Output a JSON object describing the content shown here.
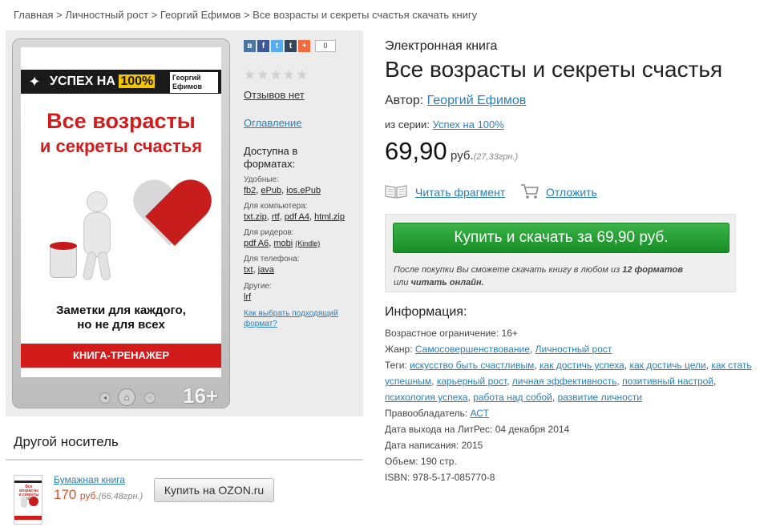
{
  "breadcrumb": {
    "home": "Главная",
    "sep": " > ",
    "cat": "Личностный рост",
    "author": "Георгий Ефимов",
    "current": "Все возрасты и секреты счастья скачать книгу"
  },
  "cover": {
    "series_prefix": "УСПЕХ НА ",
    "series_num": "100%",
    "author": "Георгий Ефимов",
    "title_l1": "Все возрасты",
    "title_l2": "и секреты счастья",
    "subtitle_l1": "Заметки для каждого,",
    "subtitle_l2": "но не для всех",
    "band": "КНИГА-ТРЕНАЖЕР",
    "age": "16+"
  },
  "social": {
    "count": "0",
    "icons": [
      "vk-icon",
      "facebook-icon",
      "twitter-icon",
      "tumblr-icon",
      "plus-icon"
    ]
  },
  "rating": {
    "stars": "★★★★★",
    "value": 0,
    "max": 5
  },
  "side": {
    "reviews": "Отзывов нет",
    "toc": "Оглавление",
    "formats_title_l1": "Доступна в",
    "formats_title_l2": "форматах:",
    "groups": [
      {
        "label": "Удобные:",
        "items": [
          "fb2",
          "ePub",
          "ios.ePub"
        ]
      },
      {
        "label": "Для компьютера:",
        "items": [
          "txt.zip",
          "rtf",
          "pdf A4",
          "html.zip"
        ]
      },
      {
        "label": "Для ридеров:",
        "items": [
          "pdf A6",
          "mobi",
          "(Kindle)"
        ]
      },
      {
        "label": "Для телефона:",
        "items": [
          "txt",
          "java"
        ]
      },
      {
        "label": "Другие:",
        "items": [
          "lrf"
        ]
      }
    ],
    "how_choose_l1": "Как выбрать подходящий",
    "how_choose_l2": "формат?"
  },
  "book": {
    "kind": "Электронная книга",
    "title": "Все возрасты и секреты счастья",
    "author_label": "Автор:",
    "author": "Георгий Ефимов",
    "series_label": "из серии:",
    "series": "Успех на 100%",
    "price": "69,90",
    "currency": "руб.",
    "price_alt": "(27,33грн.)",
    "read_fragment": "Читать фрагмент",
    "defer": "Отложить",
    "buy_button": "Купить и скачать за 69,90 руб.",
    "note_1": "После покупки Вы сможете скачать книгу в любом из ",
    "note_formats": "12 форматов",
    "note_2": "или ",
    "note_read": "читать онлайн."
  },
  "info": {
    "title": "Информация:",
    "age_label": "Возрастное ограничение:",
    "age": "16+",
    "genre_label": "Жанр:",
    "genres": [
      "Самосовершенствование",
      "Личностный рост"
    ],
    "tags_label": "Теги:",
    "tags": [
      "искусство быть счастливым",
      "как достичь успеха",
      "как достичь цели",
      "как стать успешным",
      "карьерный рост",
      "личная эффективность",
      "позитивный настрой",
      "психология успеха",
      "работа над собой",
      "развитие личности"
    ],
    "holder_label": "Правообладатель:",
    "holder": "АСТ",
    "release_label": "Дата выхода на ЛитРес:",
    "release": "04 декабря 2014",
    "written_label": "Дата написания:",
    "written": "2015",
    "volume_label": "Объем:",
    "volume": "190 стр.",
    "isbn_label": "ISBN:",
    "isbn": "978-5-17-085770-8"
  },
  "other": {
    "title": "Другой носитель",
    "paper_link": "Бумажная книга",
    "price": "170",
    "currency": "руб.",
    "price_alt": "(66,48грн.)",
    "ozon_button": "Купить на OZON.ru"
  }
}
